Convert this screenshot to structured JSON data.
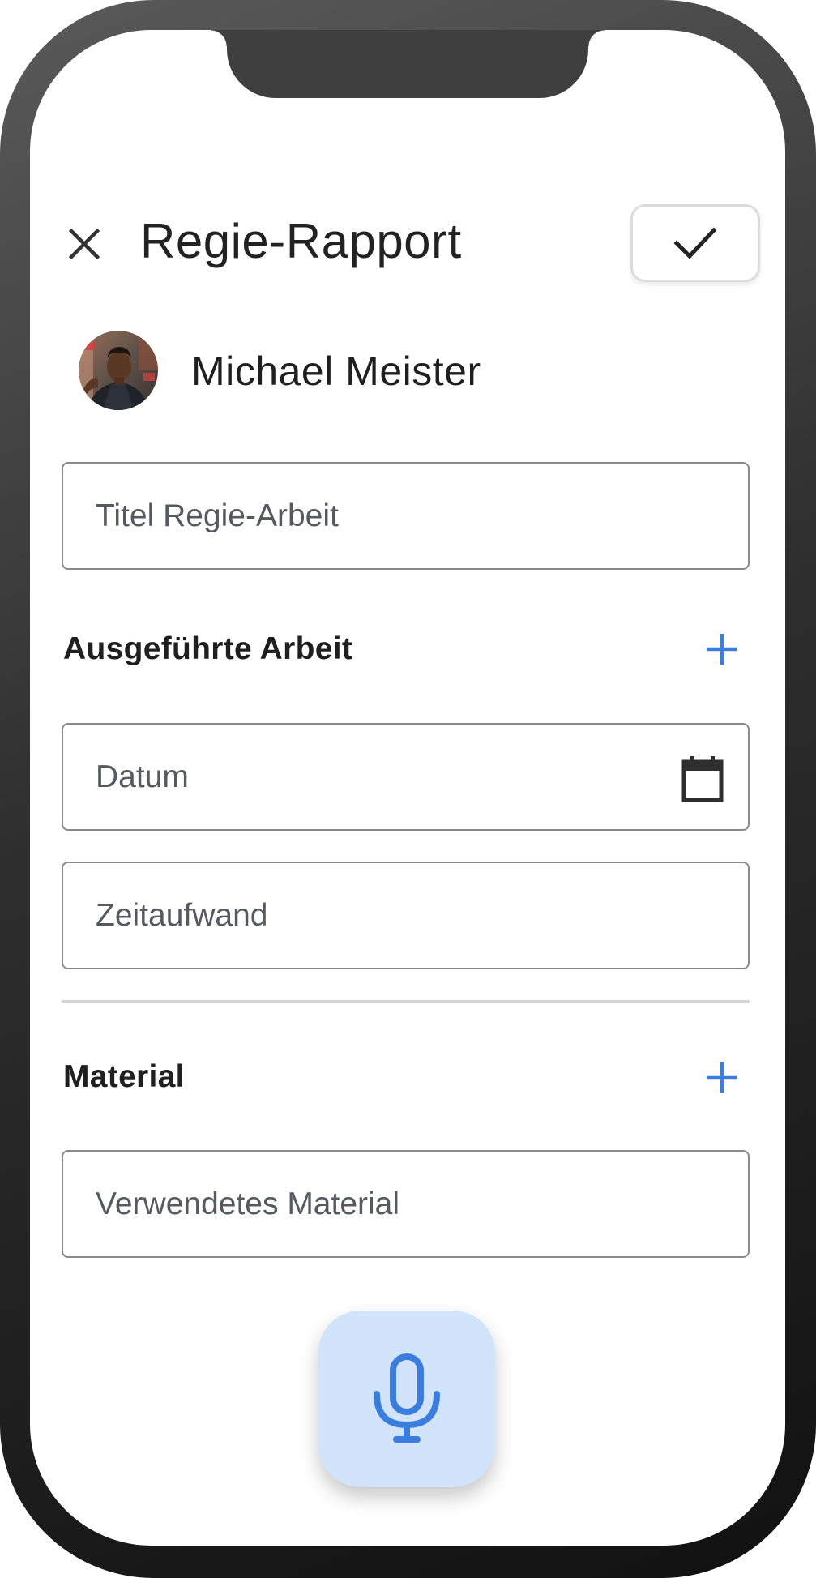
{
  "header": {
    "title": "Regie-Rapport"
  },
  "user": {
    "name": "Michael Meister"
  },
  "fields": {
    "title_placeholder": "Titel Regie-Arbeit",
    "date_placeholder": "Datum",
    "effort_placeholder": "Zeitaufwand",
    "material_placeholder": "Verwendetes Material"
  },
  "sections": {
    "work_title": "Ausgeführte Arbeit",
    "material_title": "Material"
  },
  "icons": {
    "close": "close-icon",
    "confirm": "check-icon",
    "calendar": "calendar-icon",
    "add": "plus-icon",
    "microphone": "microphone-icon"
  },
  "colors": {
    "accent": "#3b7ddd",
    "mic_bg": "#d2e3fc",
    "text": "#222222"
  }
}
